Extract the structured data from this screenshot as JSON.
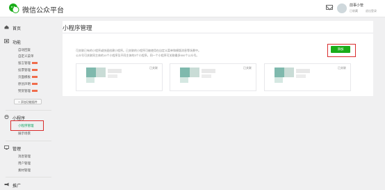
{
  "header": {
    "app_title": "微信公众平台",
    "account_name": "前事小管",
    "account_sub": "已收藏",
    "account_sub2": "退出登录"
  },
  "sidebar": {
    "home": "首页",
    "features": "功能",
    "feature_items": [
      "自动回复",
      "自定义菜单",
      "留言管理",
      "投票管理",
      "页面模板",
      "原创声明",
      "赞赏管理"
    ],
    "add_plugin": "+ 添加功能插件",
    "miniprogram": "小程序",
    "mini_items": [
      "小程序管理",
      "展示场景"
    ],
    "management": "管理",
    "mgmt_items": [
      "消息管理",
      "用户管理",
      "素材管理"
    ],
    "promotion": "推广"
  },
  "main": {
    "title": "小程序管理",
    "desc_line1": "可关联已有的小程序或快速创建小程序。已关联的小程序可被使用在自定义菜单和模版消息等场景中。",
    "desc_line2": "公众号可关联同主体的10个小程序及不同主体的3个小程序。同一个小程序可关联最多500个公众号。",
    "add_button": "添加",
    "cards": [
      {
        "status": "已关联"
      },
      {
        "status": "已关联"
      },
      {
        "status": "已关联"
      }
    ]
  },
  "colors": {
    "accent": "#1aad19",
    "highlight": "#d92c2c",
    "active_nav": "#07a15a"
  }
}
